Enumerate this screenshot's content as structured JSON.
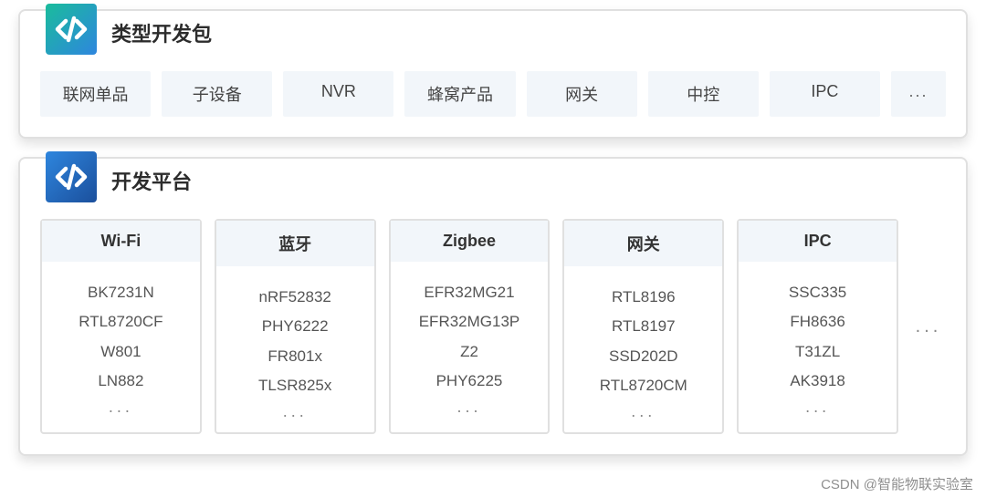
{
  "panel_types": {
    "title": "类型开发包",
    "chips": [
      "联网单品",
      "子设备",
      "NVR",
      "蜂窝产品",
      "网关",
      "中控",
      "IPC",
      "..."
    ]
  },
  "panel_platforms": {
    "title": "开发平台",
    "columns": [
      {
        "header": "Wi-Fi",
        "items": [
          "BK7231N",
          "RTL8720CF",
          "W801",
          "LN882"
        ]
      },
      {
        "header": "蓝牙",
        "items": [
          "nRF52832",
          "PHY6222",
          "FR801x",
          "TLSR825x"
        ]
      },
      {
        "header": "Zigbee",
        "items": [
          "EFR32MG21",
          "EFR32MG13P",
          "Z2",
          "PHY6225"
        ]
      },
      {
        "header": "网关",
        "items": [
          "RTL8196",
          "RTL8197",
          "SSD202D",
          "RTL8720CM"
        ]
      },
      {
        "header": "IPC",
        "items": [
          "SSC335",
          "FH8636",
          "T31ZL",
          "AK3918"
        ]
      }
    ],
    "column_more": "...",
    "side_more": "..."
  },
  "watermark": "CSDN @智能物联实验室"
}
